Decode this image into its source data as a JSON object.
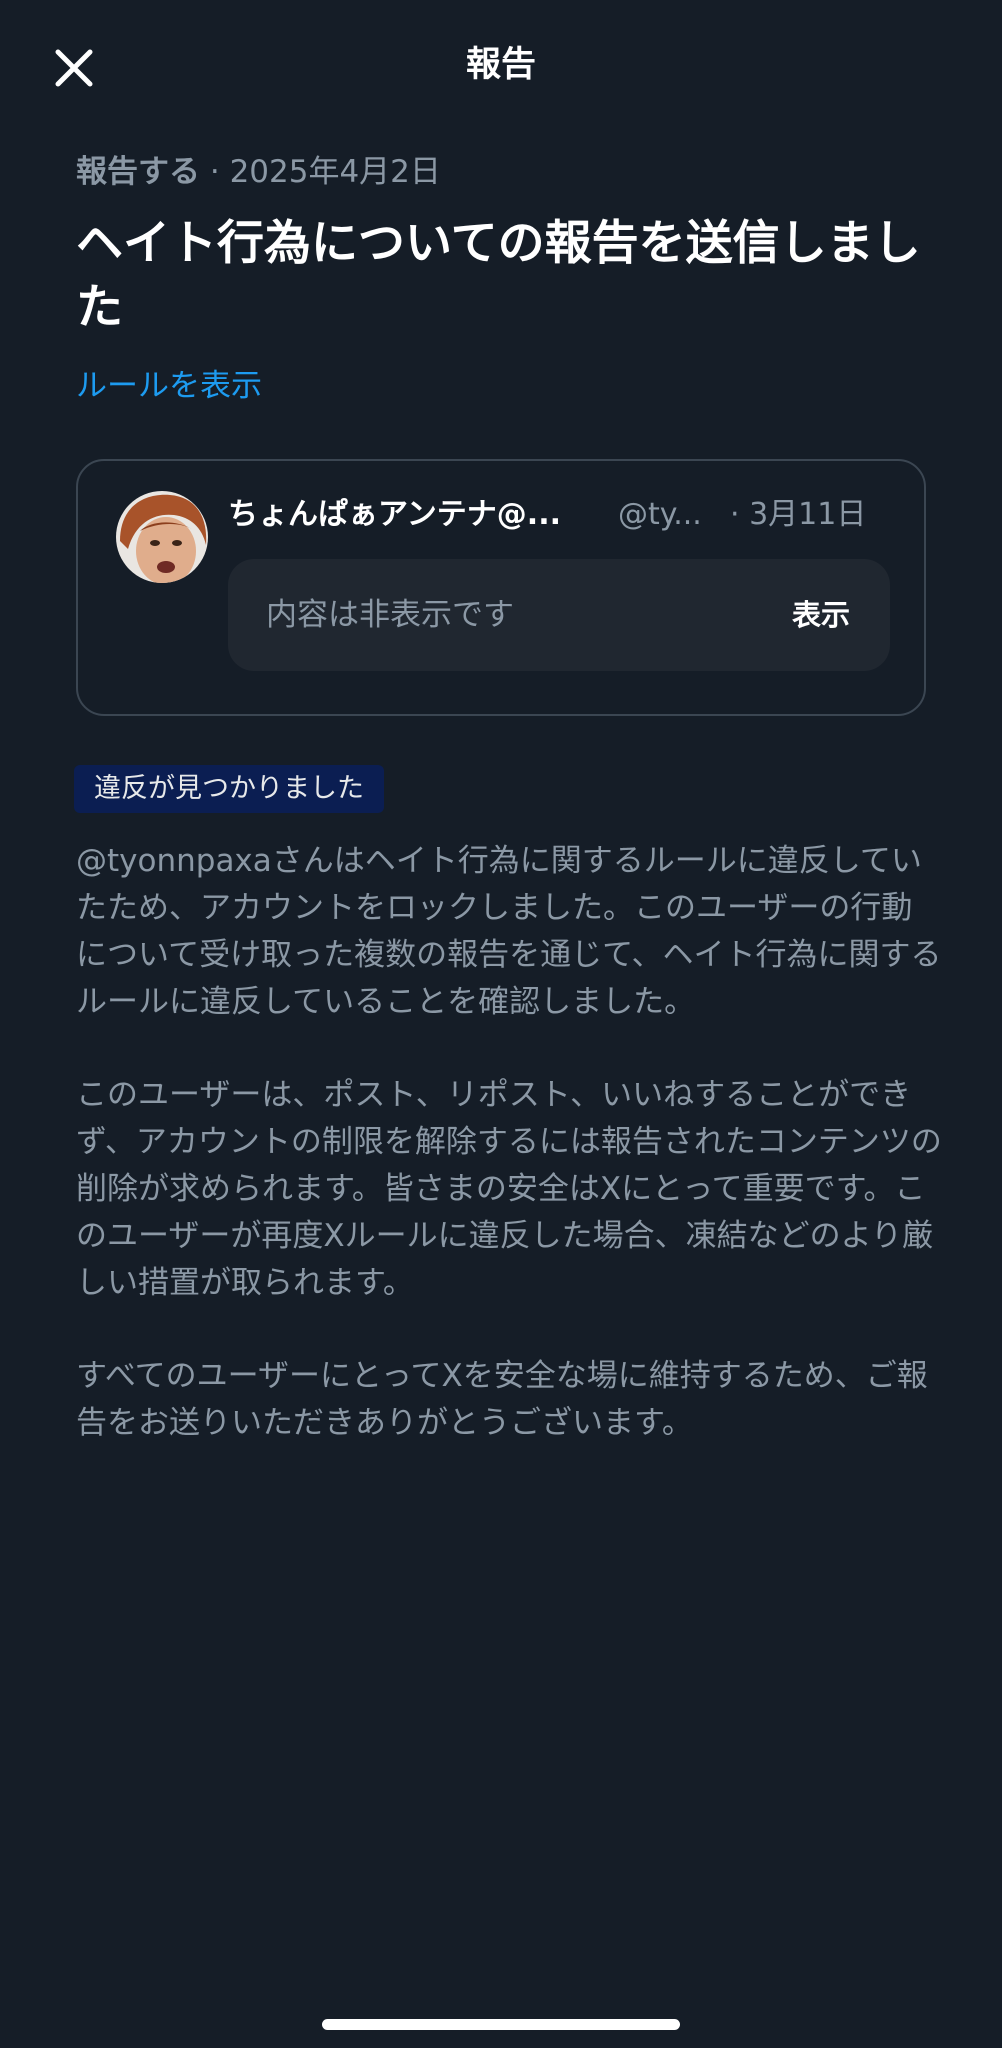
{
  "header": {
    "title": "報告",
    "close_icon": "close-icon"
  },
  "report": {
    "type_label": "報告する",
    "separator": " · ",
    "date": "2025年4月2日",
    "title": "ヘイト行為についての報告を送信しました",
    "rules_link": "ルールを表示"
  },
  "post": {
    "author_name": "ちょんぱぁアンテナ@...",
    "handle": "@ty...",
    "date": "· 3月11日",
    "hidden_text": "内容は非表示です",
    "show_label": "表示"
  },
  "result": {
    "badge": "違反が見つかりました",
    "paragraphs": [
      "@tyonnpaxaさんはヘイト行為に関するルールに違反していたため、アカウントをロックしました。このユーザーの行動について受け取った複数の報告を通じて、ヘイト行為に関するルールに違反していることを確認しました。",
      "このユーザーは、ポスト、リポスト、いいねすることができず、アカウントの制限を解除するには報告されたコンテンツの削除が求められます。皆さまの安全はXにとって重要です。このユーザーが再度Xルールに違反した場合、凍結などのより厳しい措置が取られます。",
      "すべてのユーザーにとってXを安全な場に維持するため、ご報告をお送りいただきありがとうございます。"
    ]
  },
  "colors": {
    "background": "#151d27",
    "link": "#1d9bf0",
    "muted_text": "#8b98a5",
    "badge_bg": "#0b1e52",
    "card_border": "#3b4652"
  }
}
